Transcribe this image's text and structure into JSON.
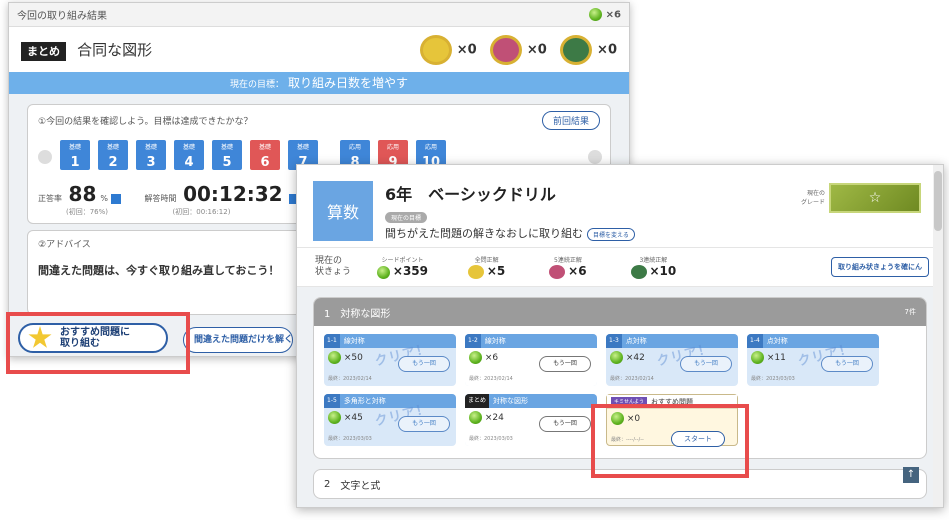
{
  "result_window": {
    "topbar_title": "今回の取り組み結果",
    "gem_count": "×6",
    "tag": "まとめ",
    "title": "合同な図形",
    "medals": [
      {
        "name": "perfect",
        "count": "×0",
        "color": "#e6c53a"
      },
      {
        "name": "combo",
        "count": "×0",
        "color": "#c05076"
      },
      {
        "name": "3combo",
        "count": "×0",
        "color": "#3d7a46"
      }
    ],
    "goal_label": "現在の目標：",
    "goal_text": "取り組み日数を増やす",
    "check_text": "①今回の結果を確認しよう。目標は達成できたかな？",
    "prev_button": "前回結果",
    "steps": [
      {
        "label": "基礎",
        "num": "1"
      },
      {
        "label": "基礎",
        "num": "2"
      },
      {
        "label": "基礎",
        "num": "3"
      },
      {
        "label": "基礎",
        "num": "4"
      },
      {
        "label": "基礎",
        "num": "5"
      },
      {
        "label": "基礎",
        "num": "6"
      },
      {
        "label": "基礎",
        "num": "7"
      },
      {
        "label": "応用",
        "num": "8"
      },
      {
        "label": "応用",
        "num": "9"
      },
      {
        "label": "応用",
        "num": "10"
      }
    ],
    "accuracy_label": "正答率",
    "accuracy_value": "88",
    "accuracy_unit": "%",
    "accuracy_initial": "(初回：76%)",
    "time_label": "解答時間",
    "time_value": "00:12:32",
    "time_initial": "(初回：00:16:12)",
    "advice_title": "②アドバイス",
    "advice_text": "間違えた問題は、今すぐ取り組み直しておこう！",
    "rec_button_line1": "おすすめ問題に",
    "rec_button_line2": "取り組む",
    "wrong_button": "間違えた問題だけを解く"
  },
  "drill_window": {
    "subject": "算数",
    "grade_title": "6年　ベーシックドリル",
    "goal_tag": "現在の目標",
    "goal_text": "間ちがえた問題の解きなおしに取り組む",
    "goal_change": "目標を変える",
    "grade_label1": "現在の",
    "grade_label2": "グレード",
    "status_label1": "現在の",
    "status_label2": "状きょう",
    "status": [
      {
        "title": "シードポイント",
        "value": "×359"
      },
      {
        "title": "全問正解",
        "value": "×5"
      },
      {
        "title": "5連続正解",
        "value": "×6"
      },
      {
        "title": "3連続正解",
        "value": "×10"
      }
    ],
    "status_button": "取り組み状きょうを確にん",
    "section1_num": "1",
    "section1_title": "対称な図形",
    "section1_count": "7件",
    "cards": [
      {
        "num": "1-1",
        "title": "線対称",
        "count": "×50",
        "date": "最終：2023/02/14",
        "stamp": "クリア！",
        "again": "もう一回"
      },
      {
        "num": "1-2",
        "title": "線対称",
        "count": "×6",
        "date": "最終：2023/02/14",
        "stamp": "",
        "again": "もう一回"
      },
      {
        "num": "1-3",
        "title": "点対称",
        "count": "×42",
        "date": "最終：2023/02/14",
        "stamp": "クリア！",
        "again": "もう一回"
      },
      {
        "num": "1-4",
        "title": "点対称",
        "count": "×11",
        "date": "最終：2023/03/03",
        "stamp": "クリア！",
        "again": "もう一回"
      },
      {
        "num": "1-5",
        "title": "多角形と対称",
        "count": "×45",
        "date": "最終：2023/03/03",
        "stamp": "クリア！",
        "again": "もう一回"
      },
      {
        "num": "まとめ",
        "title": "対称な図形",
        "count": "×24",
        "date": "最終：2023/03/03",
        "stamp": "",
        "again": "もう一回"
      }
    ],
    "rec_card": {
      "tag": "キミせんよう",
      "title": "おすすめ問題",
      "count": "×0",
      "date": "最終：----/--/--",
      "start": "スタート"
    },
    "section2_num": "2",
    "section2_title": "文字と式",
    "back_top": "↑"
  }
}
